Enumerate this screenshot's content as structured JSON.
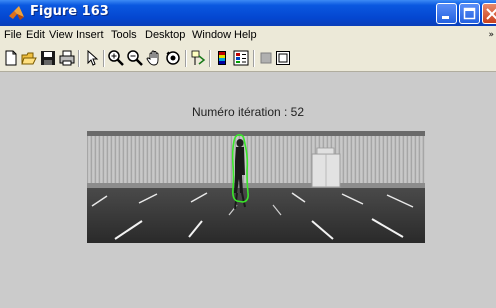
{
  "window": {
    "title": "Figure 163",
    "app_icon": "matlab-icon",
    "controls": [
      "minimize-icon",
      "maximize-icon",
      "close-icon"
    ]
  },
  "menu": {
    "items": [
      "File",
      "Edit",
      "View",
      "Insert",
      "Tools",
      "Desktop",
      "Window",
      "Help"
    ],
    "overflow_icon": "chevron-icon"
  },
  "toolbar": {
    "icons": [
      "new-figure-icon",
      "open-file-icon",
      "save-figure-icon",
      "print-figure-icon",
      "edit-plot-icon",
      "zoom-in-icon",
      "zoom-out-icon",
      "pan-icon",
      "rotate-3d-icon",
      "data-cursor-icon",
      "insert-colorbar-icon",
      "insert-legend-icon",
      "hide-plot-tools-icon",
      "show-plot-tools-icon"
    ]
  },
  "figure": {
    "iteration_label": "Numéro itération :  52",
    "contour_color": "#39e829"
  },
  "colors": {
    "titlebar": "#0a58e0",
    "figure_background": "#cbcbcb",
    "menubar": "#ece9d8"
  }
}
